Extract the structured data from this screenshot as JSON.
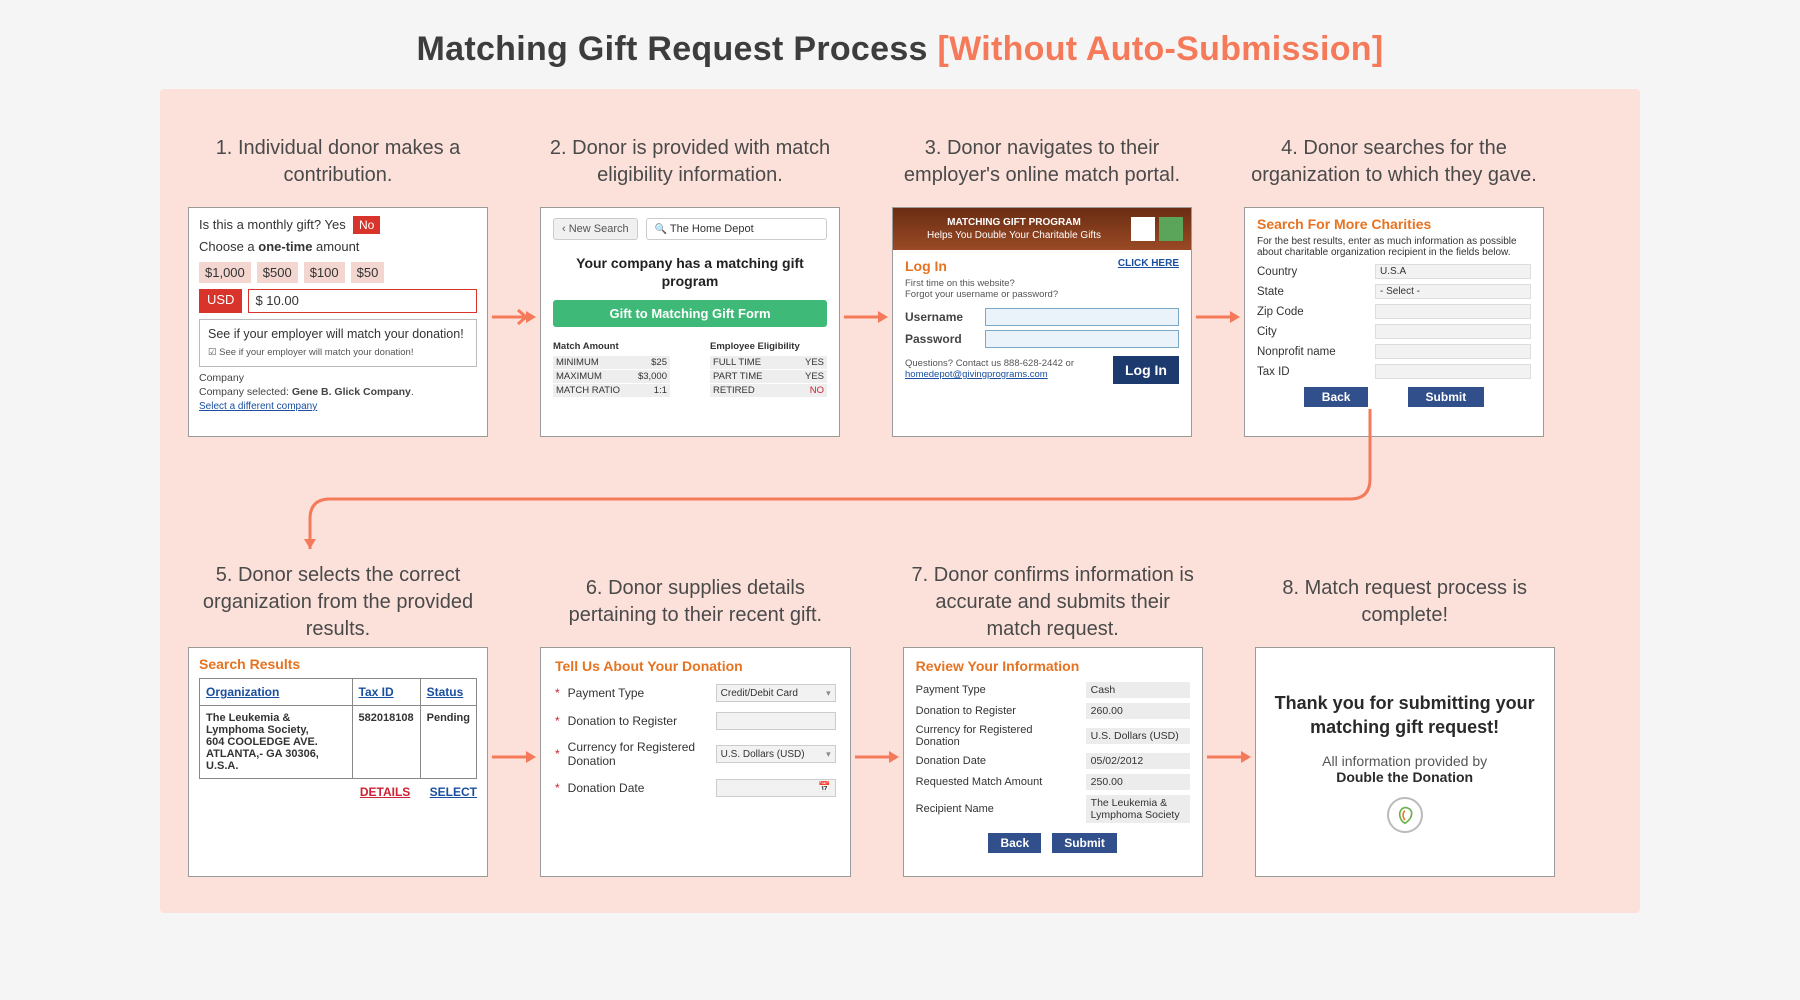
{
  "header": {
    "title_a": "Matching Gift Request Process ",
    "title_b": "[Without Auto-Submission]"
  },
  "steps": [
    {
      "n": "1.",
      "title": "Individual donor makes a contribution."
    },
    {
      "n": "2.",
      "title": "Donor is provided with match eligibility information."
    },
    {
      "n": "3.",
      "title": "Donor navigates to their employer's online match portal."
    },
    {
      "n": "4.",
      "title": "Donor searches for the organization to which they gave."
    },
    {
      "n": "5.",
      "title": "Donor selects the correct organization from the provided results."
    },
    {
      "n": "6.",
      "title": "Donor supplies details pertaining to their recent gift."
    },
    {
      "n": "7.",
      "title": "Donor confirms information is accurate and submits their match request."
    },
    {
      "n": "8.",
      "title": "Match request process is complete!"
    }
  ],
  "s1": {
    "monthly_q": "Is this a monthly gift?   Yes",
    "no": "No",
    "choose_pre": "Choose a ",
    "choose_bold": "one-time",
    "choose_post": " amount",
    "amounts": [
      "$1,000",
      "$500",
      "$100",
      "$50"
    ],
    "usd": "USD",
    "custom": "$ 10.00",
    "emp_prompt": "See if your employer will match your donation!",
    "emp_sub": "☑ See if your employer will match your donation!",
    "company_label": "Company",
    "company_selected_pre": "Company selected: ",
    "company_selected": "Gene B. Glick Company",
    "select_diff": "Select a different company"
  },
  "s2": {
    "new_search": "New Search",
    "search_value": "The Home Depot",
    "headline": "Your company has a matching gift program",
    "cta": "Gift to Matching Gift Form",
    "match_amount_h": "Match Amount",
    "emp_elig_h": "Employee Eligibility",
    "rows_l": [
      [
        "MINIMUM",
        "$25"
      ],
      [
        "MAXIMUM",
        "$3,000"
      ],
      [
        "MATCH RATIO",
        "1:1"
      ]
    ],
    "rows_r": [
      [
        "FULL TIME",
        "YES"
      ],
      [
        "PART TIME",
        "YES"
      ],
      [
        "RETIRED",
        "NO"
      ]
    ]
  },
  "s3": {
    "banner_a": "MATCHING GIFT PROGRAM",
    "banner_b": "Helps You Double Your Charitable Gifts",
    "login": "Log In",
    "click_here": "CLICK HERE",
    "first": "First time on this website?",
    "forgot": "Forgot your username or password?",
    "user": "Username",
    "pass": "Password",
    "questions": "Questions? Contact us 888-628-2442 or ",
    "email": "homedepot@givingprograms.com",
    "login_btn": "Log In"
  },
  "s4": {
    "h": "Search For More Charities",
    "p": "For the best results, enter as much information as possible about charitable organization recipient in the fields below.",
    "fields": [
      {
        "label": "Country",
        "val": "U.S.A"
      },
      {
        "label": "State",
        "val": "- Select -"
      },
      {
        "label": "Zip Code",
        "val": ""
      },
      {
        "label": "City",
        "val": ""
      },
      {
        "label": "Nonprofit name",
        "val": ""
      },
      {
        "label": "Tax ID",
        "val": ""
      }
    ],
    "back": "Back",
    "submit": "Submit"
  },
  "s5": {
    "h": "Search Results",
    "cols": [
      "Organization",
      "Tax ID",
      "Status"
    ],
    "org": "The Leukemia & Lymphoma Society,\n604 COOLEDGE AVE. ATLANTA,- GA 30306, U.S.A.",
    "taxid": "582018108",
    "status": "Pending",
    "details": "DETAILS",
    "select": "SELECT"
  },
  "s6": {
    "h": "Tell Us About Your Donation",
    "fields": [
      {
        "label": "Payment Type",
        "val": "Credit/Debit Card",
        "dd": true
      },
      {
        "label": "Donation to Register",
        "val": "",
        "dd": false
      },
      {
        "label": "Currency for Registered Donation",
        "val": "U.S. Dollars (USD)",
        "dd": true
      },
      {
        "label": "Donation Date",
        "val": "",
        "cal": true
      }
    ]
  },
  "s7": {
    "h": "Review Your Information",
    "rows": [
      [
        "Payment Type",
        "Cash"
      ],
      [
        "Donation to Register",
        "260.00"
      ],
      [
        "Currency for Registered Donation",
        "U.S. Dollars (USD)"
      ],
      [
        "Donation Date",
        "05/02/2012"
      ],
      [
        "Requested Match Amount",
        "250.00"
      ],
      [
        "Recipient Name",
        "The Leukemia & Lymphoma Society"
      ]
    ],
    "back": "Back",
    "submit": "Submit"
  },
  "s8": {
    "thanks": "Thank you for submitting your matching gift request!",
    "provided": "All information provided by",
    "brand": "Double the Donation"
  }
}
